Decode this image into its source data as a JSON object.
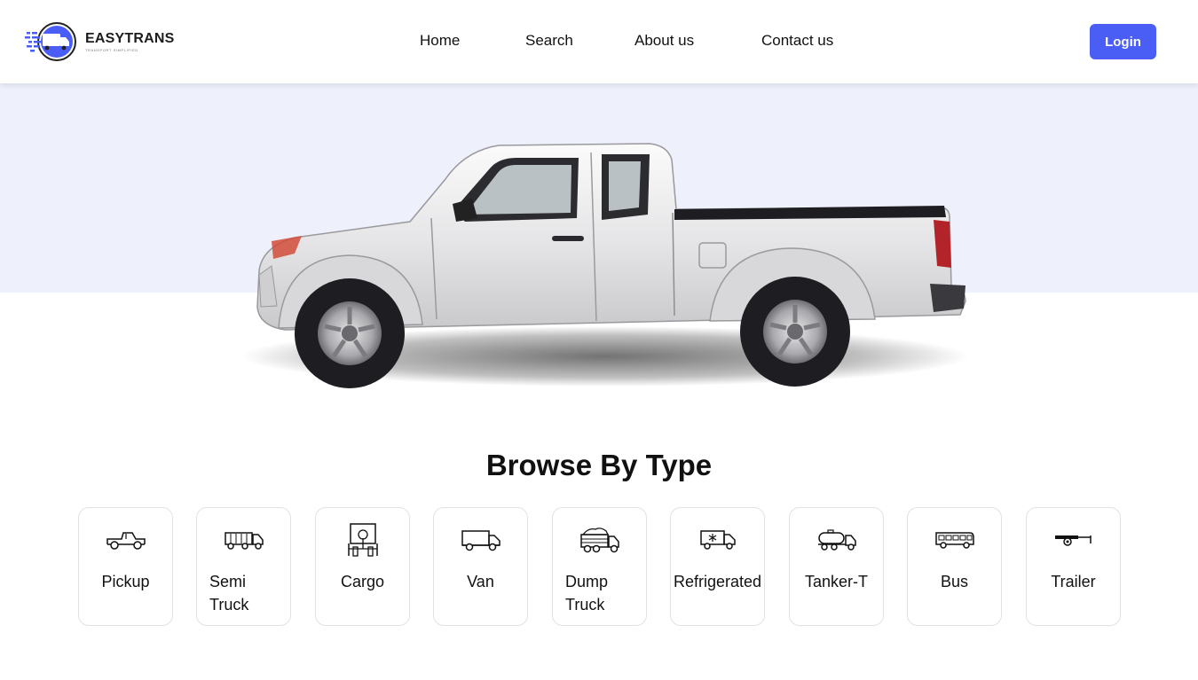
{
  "header": {
    "brand": "EASYTRANS",
    "tagline": "TRANSPORT SIMPLIFIED",
    "nav": [
      "Home",
      "Search",
      "About us",
      "Contact us"
    ],
    "login_label": "Login"
  },
  "colors": {
    "accent": "#4a5ef5",
    "hero_band": "#eef0fb"
  },
  "hero": {
    "image": "pickup-truck-icon"
  },
  "browse": {
    "title": "Browse By Type",
    "types": [
      {
        "label": "Pickup",
        "icon": "pickup-icon"
      },
      {
        "label": "Semi Truck",
        "icon": "semi-truck-icon"
      },
      {
        "label": "Cargo",
        "icon": "cargo-icon"
      },
      {
        "label": "Van",
        "icon": "van-icon"
      },
      {
        "label": "Dump Truck",
        "icon": "dump-truck-icon"
      },
      {
        "label": "Refrigerated",
        "icon": "refrigerated-truck-icon"
      },
      {
        "label": "Tanker-T",
        "icon": "tanker-truck-icon"
      },
      {
        "label": "Bus",
        "icon": "bus-icon"
      },
      {
        "label": "Trailer",
        "icon": "trailer-icon"
      }
    ]
  }
}
